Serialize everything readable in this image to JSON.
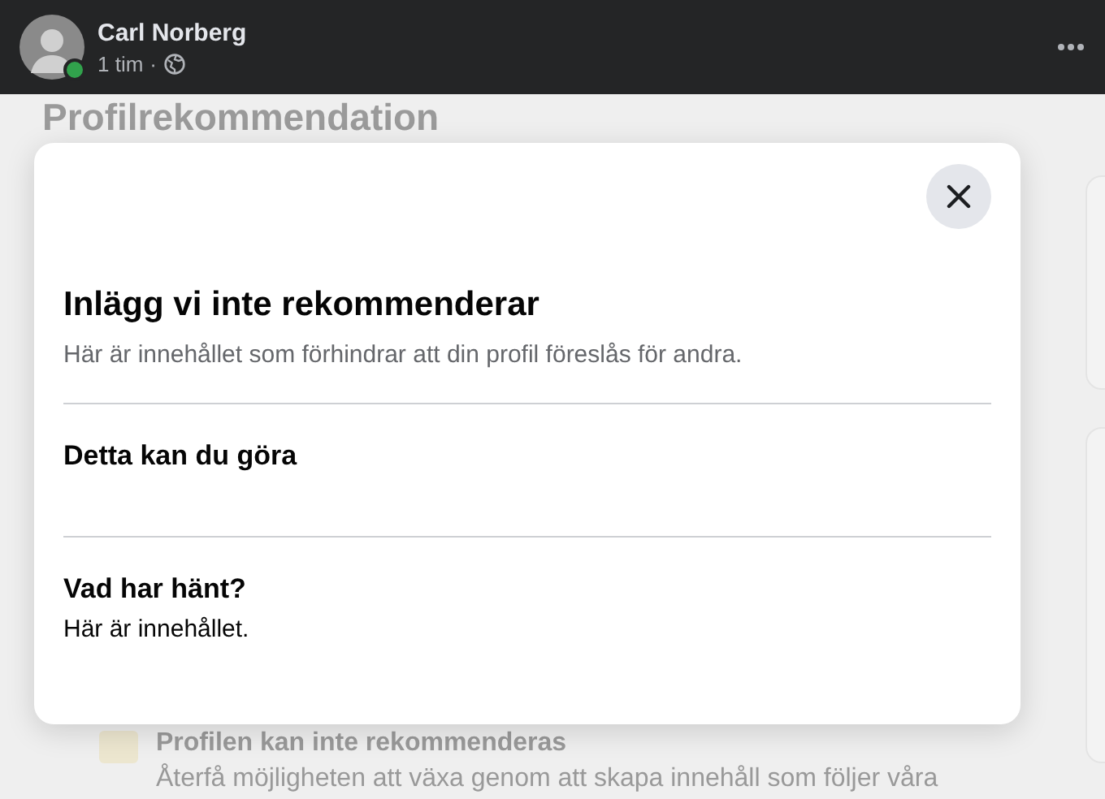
{
  "post_header": {
    "author": "Carl Norberg",
    "online": true,
    "time": "1 tim",
    "separator": "·"
  },
  "background": {
    "heading": "Profilrekommendation",
    "status_title": "Profilen kan inte rekommenderas",
    "status_text": "Återfå möjligheten att växa genom att skapa innehåll som följer våra"
  },
  "dialog": {
    "title": "Inlägg vi inte rekommenderar",
    "subtitle": "Här är innehållet som förhindrar att din profil föreslås för andra.",
    "sections": [
      {
        "heading": "Detta kan du göra"
      },
      {
        "heading": "Vad har hänt?",
        "text": "Här är innehållet."
      }
    ]
  }
}
